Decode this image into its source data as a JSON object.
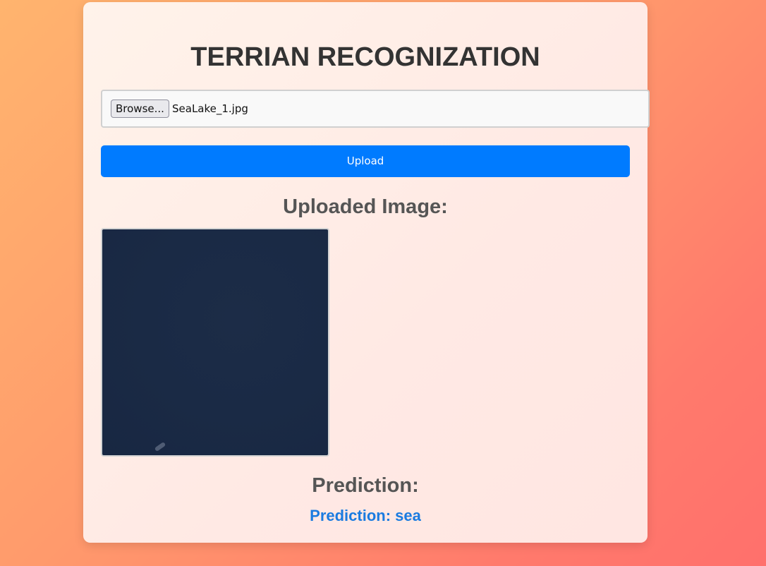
{
  "page": {
    "title": "TERRIAN RECOGNIZATION"
  },
  "file_input": {
    "browse_label": "Browse...",
    "selected_file": "SeaLake_1.jpg"
  },
  "upload": {
    "label": "Upload"
  },
  "uploaded_section": {
    "heading": "Uploaded Image:"
  },
  "prediction_section": {
    "heading": "Prediction:",
    "result_text": "Prediction: sea"
  },
  "colors": {
    "accent": "#007bff",
    "prediction_text": "#1a7be0",
    "heading_text": "#333333",
    "subheading_text": "#555555"
  }
}
